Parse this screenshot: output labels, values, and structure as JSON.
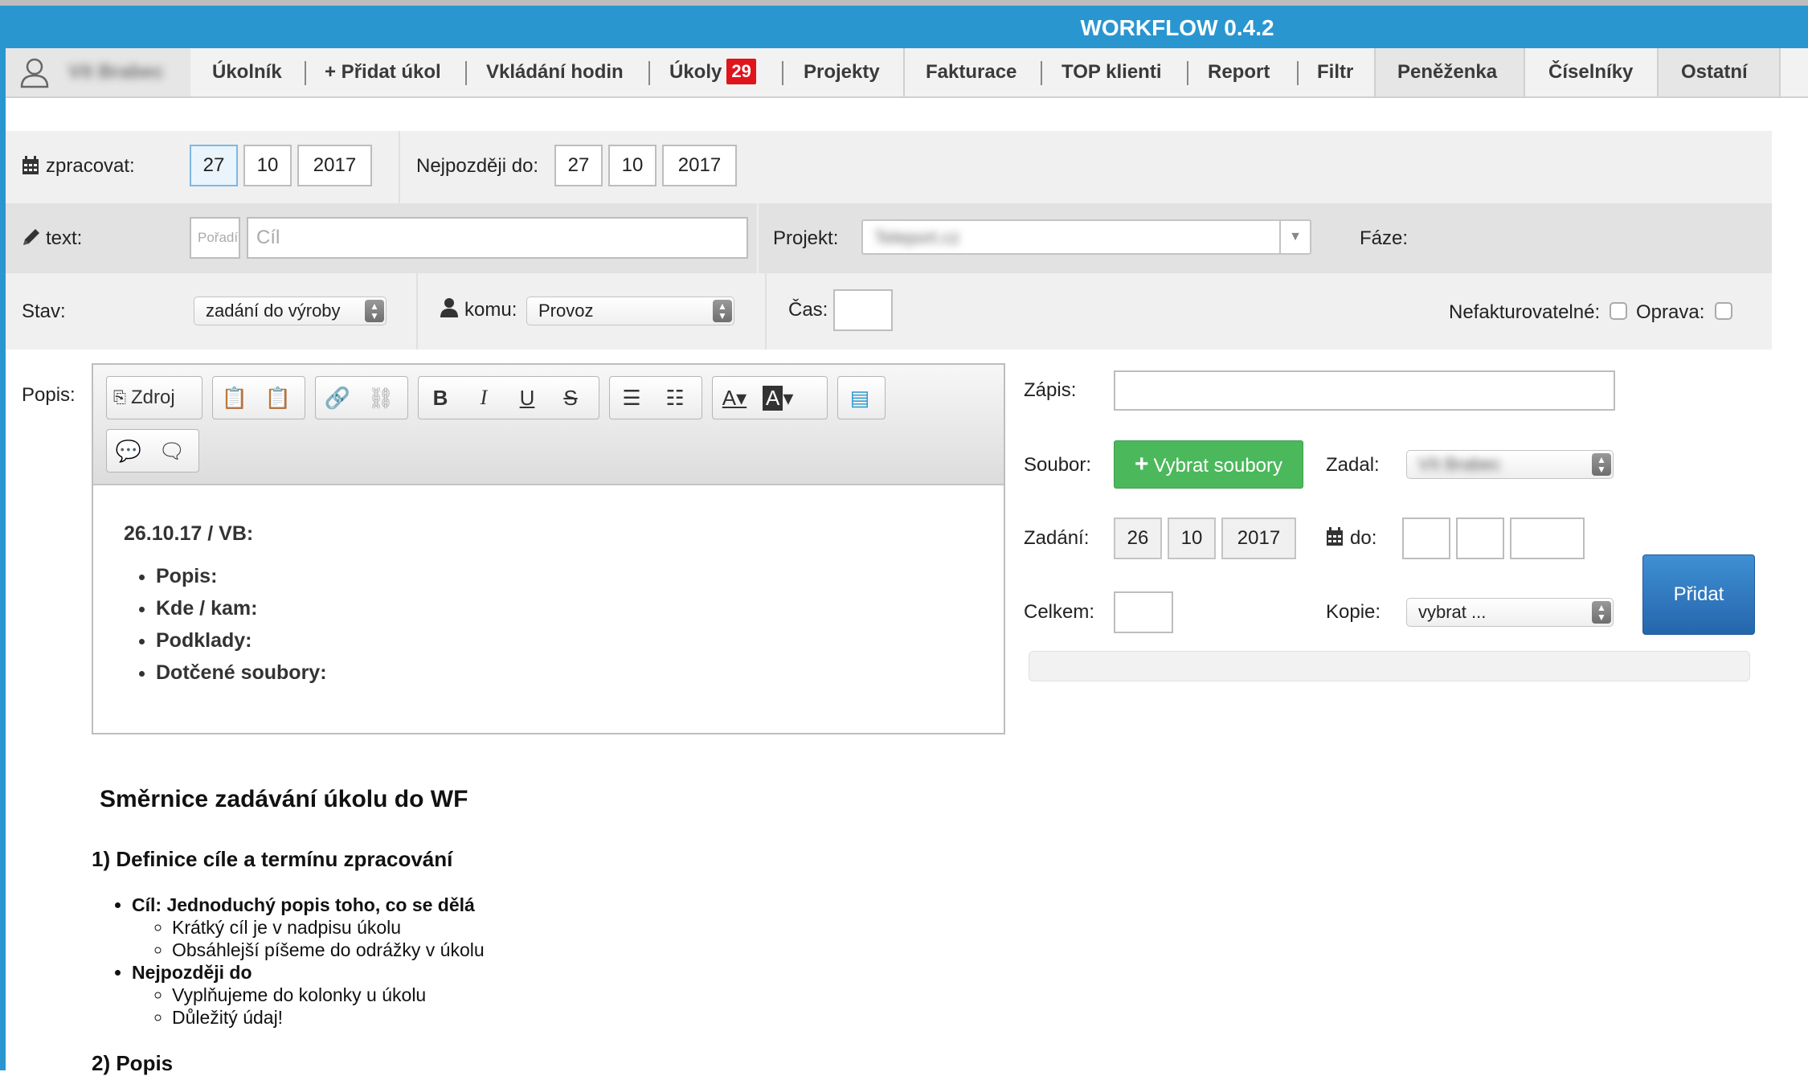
{
  "app": {
    "title": "WORKFLOW 0.4.2"
  },
  "nav": {
    "user_name": "Vít Brabec",
    "items": [
      "Úkolník",
      "+ Přidat úkol",
      "Vkládání hodin",
      "Úkoly",
      "Projekty",
      "Fakturace",
      "TOP klienti",
      "Report",
      "Filtr",
      "Peněženka",
      "Číselníky",
      "Ostatní"
    ],
    "ukoly_badge": "29"
  },
  "form": {
    "zpracovat_label": "zpracovat:",
    "zpracovat": {
      "day": "27",
      "month": "10",
      "year": "2017"
    },
    "nejpozdeji_label": "Nejpozději do:",
    "nejpozdeji": {
      "day": "27",
      "month": "10",
      "year": "2017"
    },
    "text_label": "text:",
    "poradi_placeholder": "Pořadí",
    "cil_placeholder": "Cíl",
    "projekt_label": "Projekt:",
    "projekt_value": "Teleport.cz",
    "faze_label": "Fáze:",
    "stav_label": "Stav:",
    "stav_value": "zadání do výroby",
    "komu_label": "komu:",
    "komu_value": "Provoz",
    "cas_label": "Čas:",
    "nefakturovatelne_label": "Nefakturovatelné:",
    "oprava_label": "Oprava:",
    "popis_label": "Popis:",
    "zapis_label": "Zápis:",
    "soubor_label": "Soubor:",
    "vybrat_soubory": "Vybrat soubory",
    "zadal_label": "Zadal:",
    "zadal_value": "Vít Brabec",
    "zadani_label": "Zadání:",
    "zadani": {
      "day": "26",
      "month": "10",
      "year": "2017"
    },
    "do_label": "do:",
    "celkem_label": "Celkem:",
    "kopie_label": "Kopie:",
    "kopie_value": "vybrat ...",
    "pridat": "Přidat"
  },
  "editor": {
    "zdroj": "Zdroj",
    "heading": "26.10.17 / VB:",
    "bullets": [
      "Popis:",
      "Kde / kam:",
      "Podklady:",
      "Dotčené soubory:"
    ]
  },
  "guide": {
    "title": "Směrnice zadávání úkolu do WF",
    "section1": "1) Definice cíle a termínu zpracování",
    "cil_head": "Cíl: Jednoduchý popis toho, co se dělá",
    "cil_sub": [
      "Krátký cíl je v nadpisu úkolu",
      "Obsáhlejší píšeme do odrážky v úkolu"
    ],
    "nejpozdeji_head": "Nejpozději do",
    "nejpozdeji_sub": [
      "Vyplňujeme do kolonky u úkolu",
      "Důležitý údaj!"
    ],
    "section2": "2) Popis"
  },
  "colors": {
    "header": "#2a96d0",
    "badge": "#e0141b",
    "green": "#4cb85c",
    "blue_button": "#2f7ac0"
  }
}
